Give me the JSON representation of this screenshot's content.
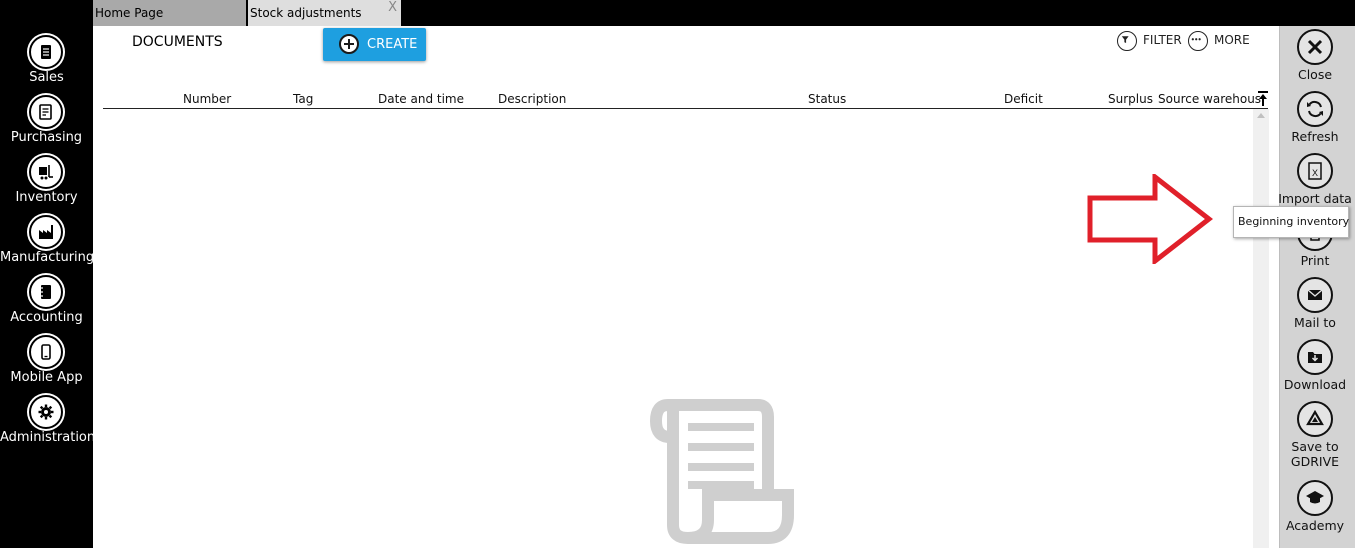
{
  "sidebar": {
    "items": [
      {
        "label": "Sales",
        "icon": "sales-icon"
      },
      {
        "label": "Purchasing",
        "icon": "purchasing-icon"
      },
      {
        "label": "Inventory",
        "icon": "inventory-icon"
      },
      {
        "label": "Manufacturing",
        "icon": "manufacturing-icon"
      },
      {
        "label": "Accounting",
        "icon": "accounting-icon"
      },
      {
        "label": "Mobile App",
        "icon": "mobile-icon"
      },
      {
        "label": "Administration",
        "icon": "gear-icon"
      }
    ]
  },
  "tabs": [
    {
      "label": "Home Page"
    },
    {
      "label": "Stock adjustments",
      "close": "X"
    }
  ],
  "header": {
    "title": "DOCUMENTS",
    "create_label": "CREATE",
    "filter_label": "FILTER",
    "more_label": "MORE"
  },
  "table": {
    "columns": [
      "Number",
      "Tag",
      "Date and time",
      "Description",
      "Status",
      "Deficit",
      "Surplus",
      "Source warehous"
    ]
  },
  "right_panel": {
    "items": [
      {
        "label": "Close",
        "icon": "close-icon"
      },
      {
        "label": "Refresh",
        "icon": "refresh-icon"
      },
      {
        "label": "Import data",
        "icon": "excel-icon"
      },
      {
        "label": "Print",
        "icon": "print-icon"
      },
      {
        "label": "Mail to",
        "icon": "mail-icon"
      },
      {
        "label": "Download",
        "icon": "download-icon"
      },
      {
        "label": "Save to GDRIVE",
        "icon": "gdrive-icon"
      },
      {
        "label": "Academy",
        "icon": "academy-icon"
      }
    ]
  },
  "tooltip": {
    "text": "Beginning inventory"
  },
  "colors": {
    "accent": "#1e9fe0",
    "arrow": "#e0202a",
    "sidebar_bg": "#000000",
    "panel_bg": "#d3d3d3"
  }
}
